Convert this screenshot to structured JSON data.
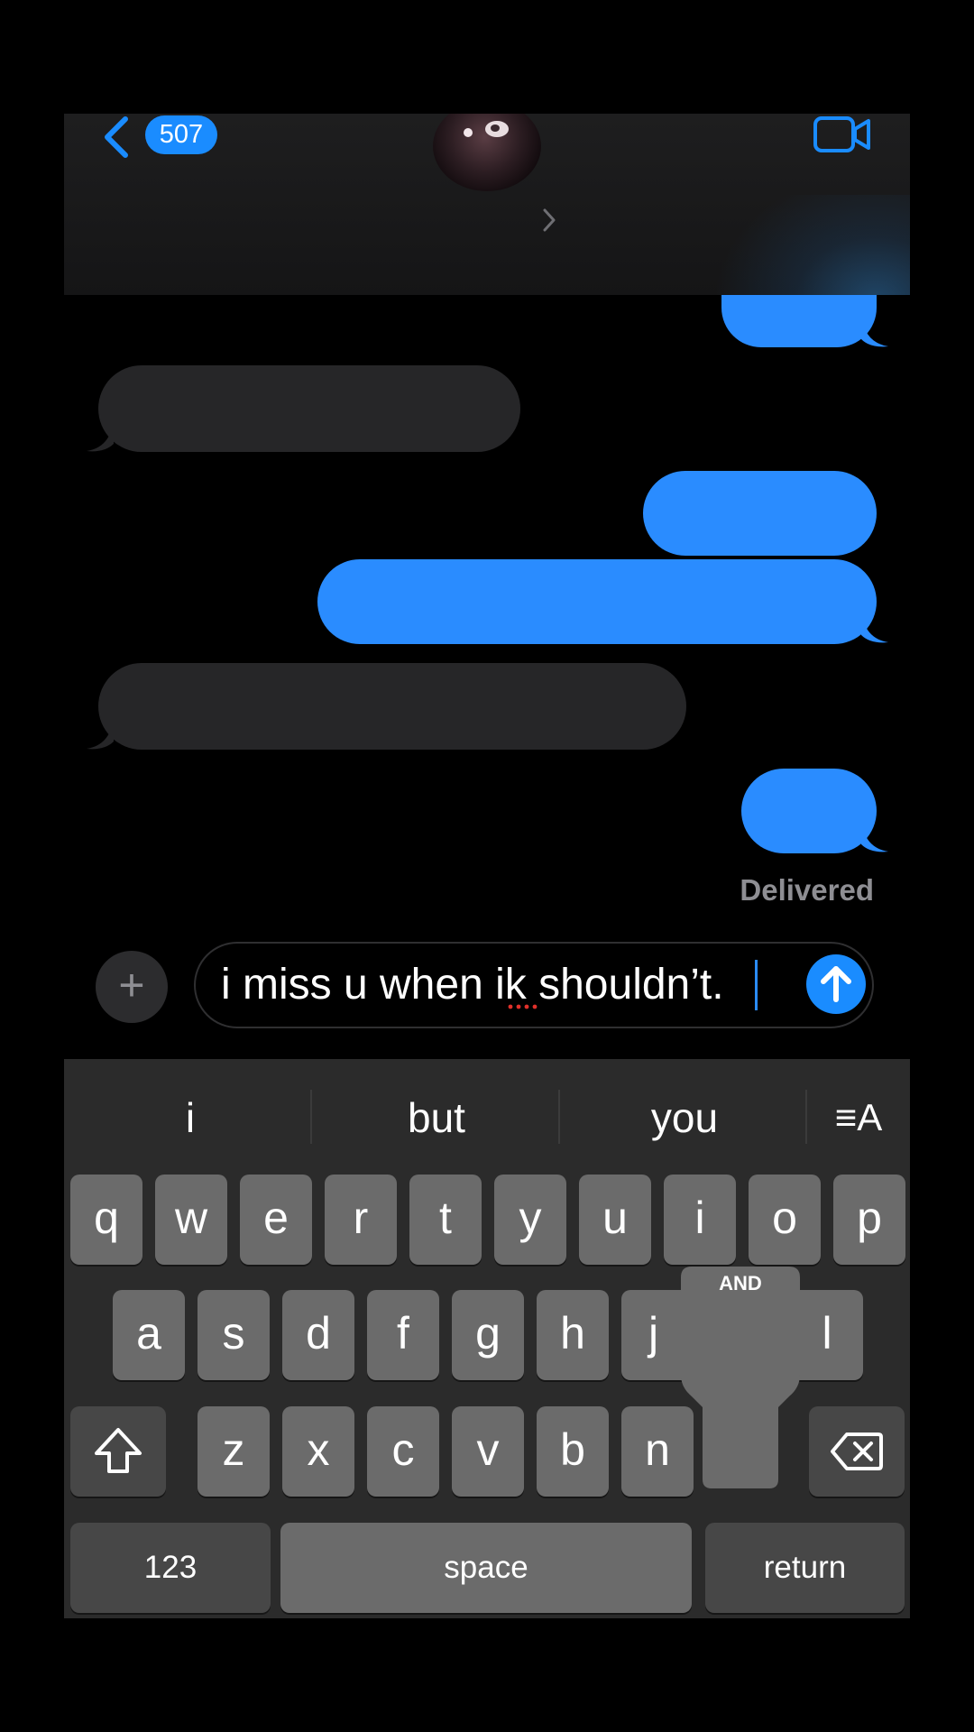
{
  "header": {
    "unread_count": "507",
    "back_icon": "chevron-left-icon",
    "video_icon": "video-camera-icon"
  },
  "conversation": {
    "status": "Delivered"
  },
  "composer": {
    "message_text": "i miss u when ik shouldn’t.",
    "plus_label": "+"
  },
  "keyboard": {
    "suggestions": [
      "i",
      "but",
      "you"
    ],
    "format_icon_label": "≡A",
    "row1": [
      "q",
      "w",
      "e",
      "r",
      "t",
      "y",
      "u",
      "i",
      "o",
      "p"
    ],
    "row2": [
      "a",
      "s",
      "d",
      "f",
      "g",
      "h",
      "j",
      "l"
    ],
    "row3": [
      "z",
      "x",
      "c",
      "v",
      "b",
      "n"
    ],
    "numbers_label": "123",
    "space_label": "space",
    "return_label": "return",
    "popup_label": "AND"
  },
  "colors": {
    "accent": "#1a8cff",
    "sent_bubble": "#2a8cff",
    "received_bubble": "#262628",
    "keyboard_bg": "#2b2b2b",
    "key_bg": "#6b6b6b"
  }
}
